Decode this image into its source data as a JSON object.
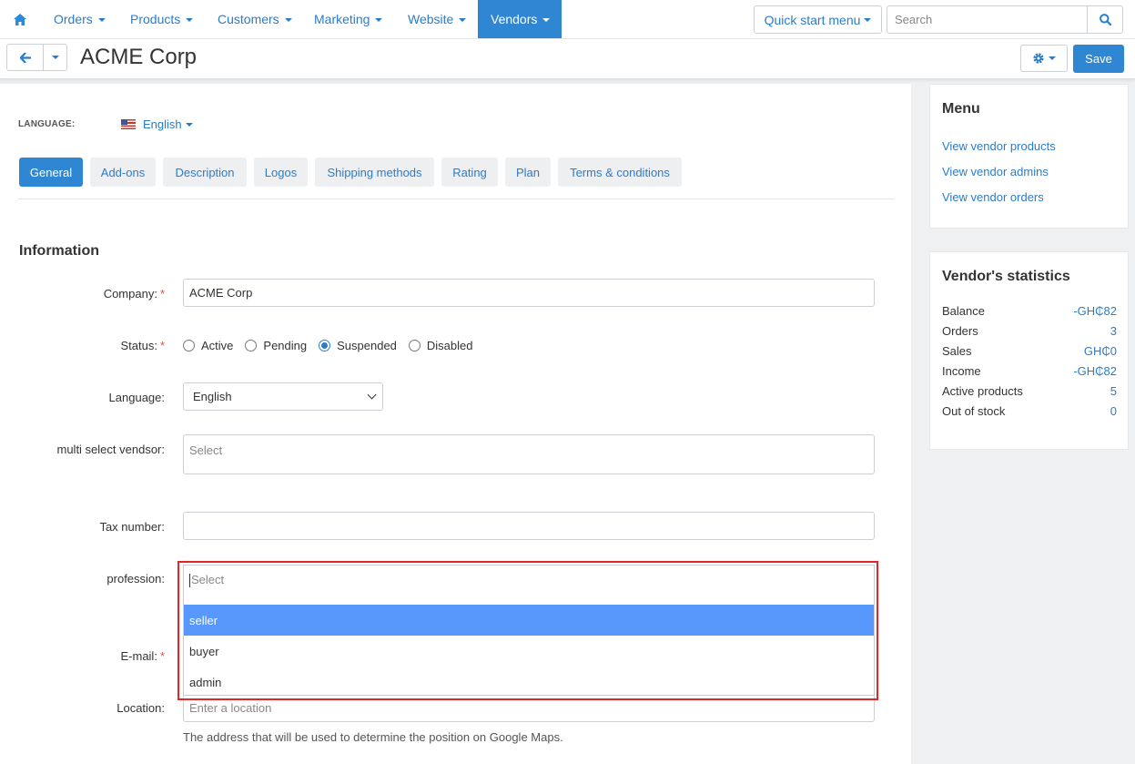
{
  "nav": {
    "items": [
      {
        "label": "Orders"
      },
      {
        "label": "Products"
      },
      {
        "label": "Customers"
      },
      {
        "label": "Marketing"
      },
      {
        "label": "Website"
      },
      {
        "label": "Vendors"
      }
    ],
    "active": "Vendors",
    "quick_start": "Quick start menu",
    "search_placeholder": "Search"
  },
  "titlebar": {
    "title": "ACME Corp",
    "save_label": "Save"
  },
  "language": {
    "label": "LANGUAGE:",
    "value": "English"
  },
  "tabs": [
    {
      "label": "General"
    },
    {
      "label": "Add-ons"
    },
    {
      "label": "Description"
    },
    {
      "label": "Logos"
    },
    {
      "label": "Shipping methods"
    },
    {
      "label": "Rating"
    },
    {
      "label": "Plan"
    },
    {
      "label": "Terms & conditions"
    }
  ],
  "active_tab": "General",
  "form": {
    "section_title": "Information",
    "company": {
      "label": "Company:",
      "value": "ACME Corp"
    },
    "status": {
      "label": "Status:",
      "options": [
        {
          "label": "Active"
        },
        {
          "label": "Pending"
        },
        {
          "label": "Suspended"
        },
        {
          "label": "Disabled"
        }
      ],
      "selected": "Suspended"
    },
    "language": {
      "label": "Language:",
      "value": "English"
    },
    "multi_select": {
      "label": "multi select vendsor:",
      "placeholder": "Select"
    },
    "tax_number": {
      "label": "Tax number:",
      "value": ""
    },
    "profession": {
      "label": "profession:",
      "placeholder": "Select",
      "options": [
        {
          "label": "seller"
        },
        {
          "label": "buyer"
        },
        {
          "label": "admin"
        }
      ],
      "highlighted": "seller"
    },
    "email": {
      "label": "E-mail:"
    },
    "location": {
      "label": "Location:",
      "placeholder": "Enter a location",
      "help": "The address that will be used to determine the position on Google Maps."
    }
  },
  "sidebar": {
    "menu_title": "Menu",
    "menu_links": [
      {
        "label": "View vendor products"
      },
      {
        "label": "View vendor admins"
      },
      {
        "label": "View vendor orders"
      }
    ],
    "stats_title": "Vendor's statistics",
    "stats": [
      {
        "key": "Balance",
        "value": "-GH₵82"
      },
      {
        "key": "Orders",
        "value": "3"
      },
      {
        "key": "Sales",
        "value": "GH₵0"
      },
      {
        "key": "Income",
        "value": "-GH₵82"
      },
      {
        "key": "Active products",
        "value": "5"
      },
      {
        "key": "Out of stock",
        "value": "0"
      }
    ]
  },
  "colors": {
    "accent": "#2f86d2",
    "link": "#2b7cc8",
    "highlight_border": "#e32526",
    "option_highlight": "#5897fb"
  }
}
